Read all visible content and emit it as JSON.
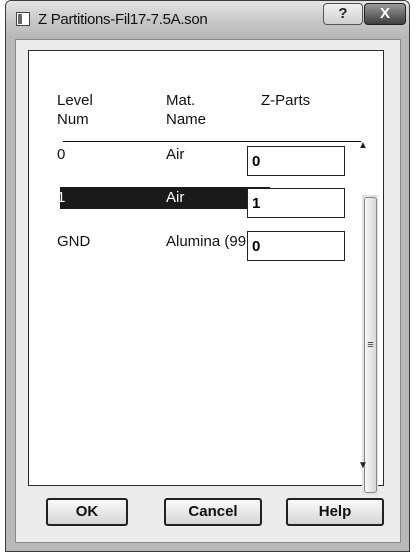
{
  "window": {
    "title": "Z Partitions-Fil17-7.5A.son",
    "help_symbol": "?",
    "close_symbol": "X"
  },
  "columns": {
    "level": [
      "Level",
      "Num"
    ],
    "mat": [
      "Mat.",
      "Name"
    ],
    "zparts": "Z-Parts"
  },
  "rows": [
    {
      "level": "0",
      "mat": "Air",
      "zparts": "0",
      "selected": false
    },
    {
      "level": "1",
      "mat": "Air",
      "zparts": "1",
      "selected": true
    },
    {
      "level": "GND",
      "mat": "Alumina (99",
      "zparts": "0",
      "selected": false
    }
  ],
  "scrollbar": {
    "up": "▲",
    "down": "▼",
    "grip": "≡"
  },
  "buttons": {
    "ok": "OK",
    "cancel": "Cancel",
    "help": "Help"
  },
  "colors": {
    "selection": "#1a1a1a",
    "selection_text": "#ffffff"
  }
}
